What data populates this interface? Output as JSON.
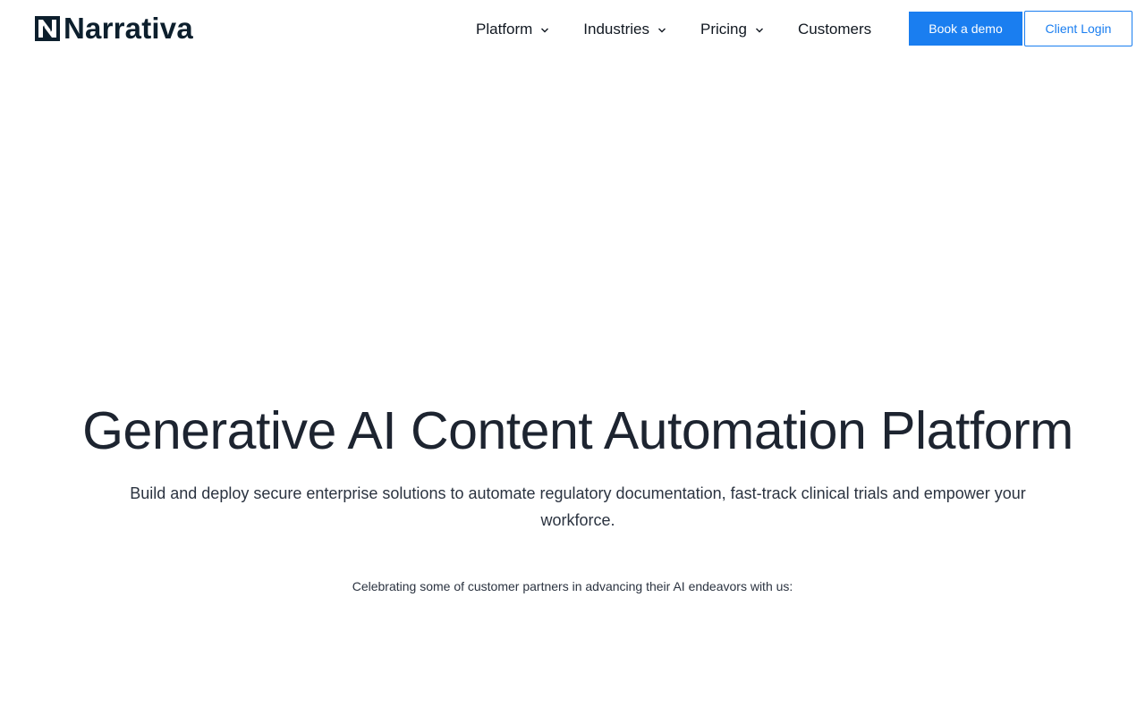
{
  "brand": {
    "name": "Narrativa",
    "color": "#0d1f2d"
  },
  "nav": {
    "items": [
      {
        "label": "Platform",
        "has_dropdown": true
      },
      {
        "label": "Industries",
        "has_dropdown": true
      },
      {
        "label": "Pricing",
        "has_dropdown": true
      },
      {
        "label": "Customers",
        "has_dropdown": false
      }
    ]
  },
  "actions": {
    "demo_label": "Book a demo",
    "login_label": "Client Login",
    "accent_color": "#1a7ef0"
  },
  "hero": {
    "title": "Generative AI Content Automation Platform",
    "subtitle": "Build and deploy secure enterprise solutions to automate regulatory documentation, fast-track clinical trials and empower your workforce.",
    "partners_note": "Celebrating some of customer partners in advancing their AI endeavors with us:"
  }
}
